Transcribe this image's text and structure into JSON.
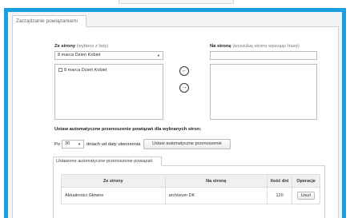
{
  "tab_title": "Zarządzanie powiązaniami",
  "from_page": {
    "label": "Ze strony",
    "hint": "(wybierz z listy)",
    "selected": "8 marca Dzień Kobiet",
    "list_items": [
      "8 marca Dzień Kobiet"
    ]
  },
  "to_page": {
    "label": "Na stronę",
    "hint": "(wyszukaj stronę wpisując frazę)",
    "placeholder": ""
  },
  "auto_transfer": {
    "heading": "Ustaw automatyczne przenoszenie powiązań dla wybranych stron:",
    "prefix": "Po",
    "days": "30",
    "suffix": "dniach od daty utworzenia",
    "button": "Ustaw automatyczne przenoszenie"
  },
  "settings_tab": "Ustawione automatyczne przenoszenie powiązań",
  "table": {
    "headers": [
      "Ze strony",
      "Na stronę",
      "Ilość dni",
      "Operacje"
    ],
    "rows": [
      {
        "from": "Aktualności Główne",
        "to": "archiwum DK",
        "days": "120",
        "op": "Usuń"
      }
    ]
  }
}
